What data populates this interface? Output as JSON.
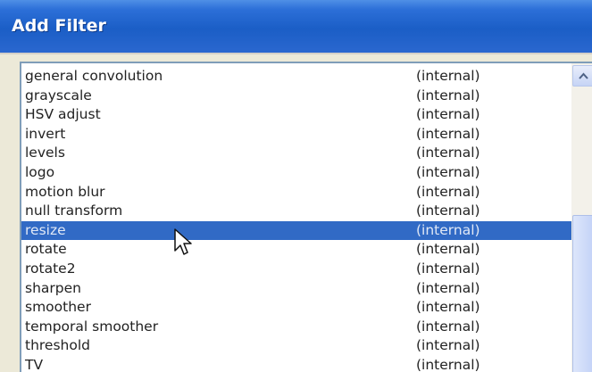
{
  "window": {
    "title": "Add Filter"
  },
  "filters": [
    {
      "name": "general convolution",
      "source": "(internal)"
    },
    {
      "name": "grayscale",
      "source": "(internal)"
    },
    {
      "name": "HSV adjust",
      "source": "(internal)"
    },
    {
      "name": "invert",
      "source": "(internal)"
    },
    {
      "name": "levels",
      "source": "(internal)"
    },
    {
      "name": "logo",
      "source": "(internal)"
    },
    {
      "name": "motion blur",
      "source": "(internal)"
    },
    {
      "name": "null transform",
      "source": "(internal)"
    },
    {
      "name": "resize",
      "source": "(internal)",
      "selected": true
    },
    {
      "name": "rotate",
      "source": "(internal)"
    },
    {
      "name": "rotate2",
      "source": "(internal)"
    },
    {
      "name": "sharpen",
      "source": "(internal)"
    },
    {
      "name": "smoother",
      "source": "(internal)"
    },
    {
      "name": "temporal smoother",
      "source": "(internal)"
    },
    {
      "name": "threshold",
      "source": "(internal)"
    },
    {
      "name": "TV",
      "source": "(internal)"
    }
  ],
  "colors": {
    "titlebar": "#1b5ec6",
    "selection": "#316ac5"
  },
  "icons": {
    "scroll_up": "chevron-up-icon",
    "pointer": "mouse-pointer-icon"
  }
}
